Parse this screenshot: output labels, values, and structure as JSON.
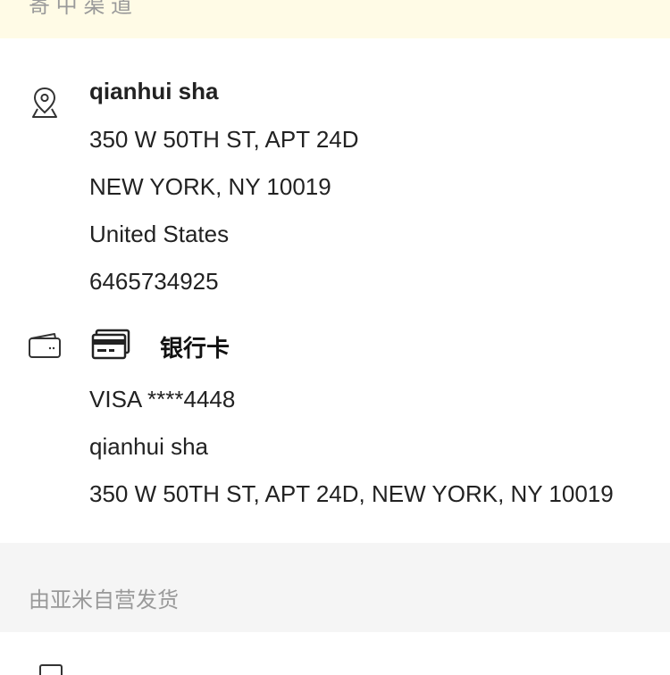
{
  "notice": {
    "text": "寄 中 渠 道"
  },
  "shipping_address": {
    "name": "qianhui sha",
    "line1": "350 W 50TH ST, APT 24D",
    "line2": "NEW YORK, NY 10019",
    "country": "United States",
    "phone": "6465734925",
    "icon": "location-pin-icon"
  },
  "payment": {
    "method_label": "银行卡",
    "card": "VISA ****4448",
    "cardholder": "qianhui sha",
    "billing_address": "350 W 50TH ST, APT 24D, NEW YORK, NY 10019",
    "icons": [
      "wallet-icon",
      "credit-card-icon"
    ]
  },
  "shipping_info": {
    "text": "由亚米自营发货"
  },
  "colors": {
    "notice_bg": "#fffbe6",
    "section_bg": "#f5f5f5",
    "muted_text": "#999999"
  }
}
